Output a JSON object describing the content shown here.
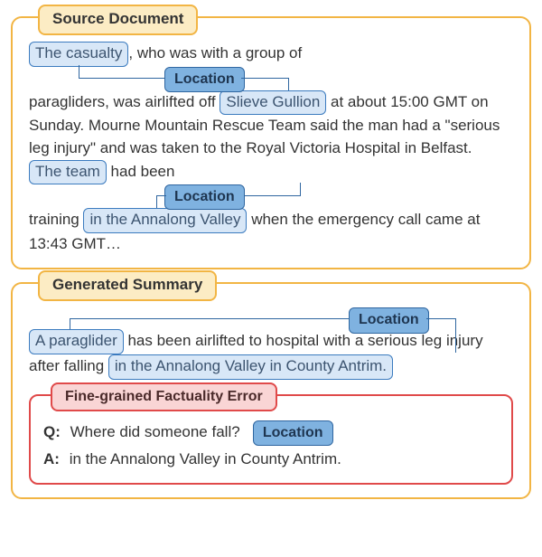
{
  "source": {
    "title": "Source Document",
    "line1_a": "The casualty",
    "line1_b": ", who was with a group of",
    "badge_loc1": "Location",
    "line2_a": "paragliders, was airlifted off ",
    "line2_b": "Slieve Gullion",
    "line2_c": " at about 15:00 GMT on Sunday. Mourne Mountain Rescue Team said the man had a \"serious leg injury\" and was taken to the Royal Victoria Hospital in Belfast. ",
    "line2_d": "The team",
    "line2_e": " had been",
    "badge_loc2": "Location",
    "line3_a": "training ",
    "line3_b": "in   the Annalong Valley",
    "line3_c": " when the emergency call came at 13:43 GMT…"
  },
  "summary": {
    "title": "Generated Summary",
    "badge_loc": "Location",
    "line_a": "A paraglider",
    "line_b": " has been airlifted to hospital with a serious leg injury after falling ",
    "line_c": "in the Annalong Valley in County Antrim."
  },
  "error": {
    "title": "Fine-grained Factuality Error",
    "q_label": "Q:",
    "q_text": "Where did someone fall?",
    "q_badge": "Location",
    "a_label": "A:",
    "a_text": " in the Annalong Valley in County Antrim."
  }
}
